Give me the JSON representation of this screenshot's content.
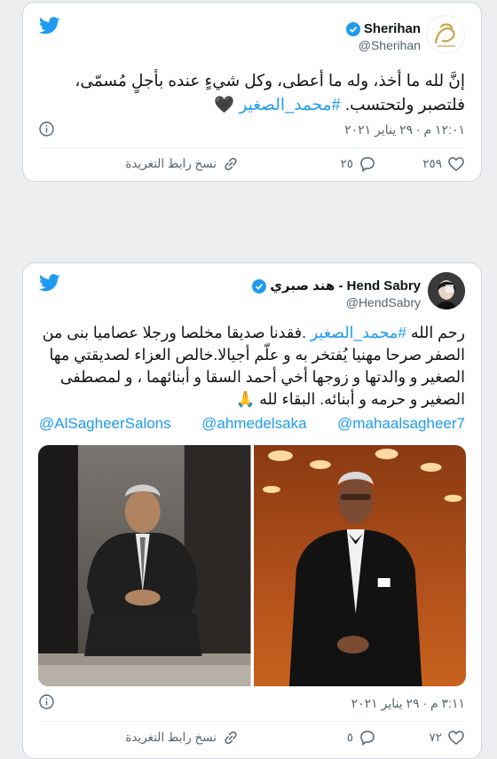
{
  "tweets": [
    {
      "display_name": "Sherihan",
      "handle": "@Sherihan",
      "text_main": "إنَّ لله ما أخذ، وله ما أعطى، وكل شيءٍ عنده بأجلٍ مُسمّى، فلتصبر ولتحتسب. ",
      "hashtag": "#محمد_الصغير",
      "emoji": "🖤",
      "timestamp": "١٢:٠١ م · ٢٩ يناير ٢٠٢١",
      "likes": "٢٥٩",
      "replies": "٢٥",
      "copy_link_label": "نسخ رابط التغريدة",
      "avatar_icon": "sherihan-logo-avatar"
    },
    {
      "display_name": "هند صبري - Hend Sabry",
      "handle": "@HendSabry",
      "text_before": "رحم الله ",
      "hashtag": "#محمد_الصغير",
      "text_after": " .فقدنا صديقا مخلصا ورجلا عصاميا بنى من الصفر صرحا مهنيا يُفتخر به و علّم أجيالا.خالص العزاء لصديقتي مها الصغير و والدتها و زوجها أخي أحمد السقا و أبنائهما ، و لمصطفى الصغير و حرمه و أبنائه. البقاء لله 🙏",
      "mentions": [
        "@AlSagheerSalons",
        "@ahmedelsaka",
        "@mahaalsagheer7"
      ],
      "timestamp": "٣:١١ م · ٢٩ يناير ٢٠٢١",
      "likes": "٧٢",
      "replies": "٥",
      "copy_link_label": "نسخ رابط التغريدة",
      "avatar_icon": "hend-sabry-photo-avatar"
    }
  ],
  "colors": {
    "accent": "#1d9bf0",
    "text": "#0f1419",
    "secondary": "#536471",
    "background": "#eceef0"
  }
}
